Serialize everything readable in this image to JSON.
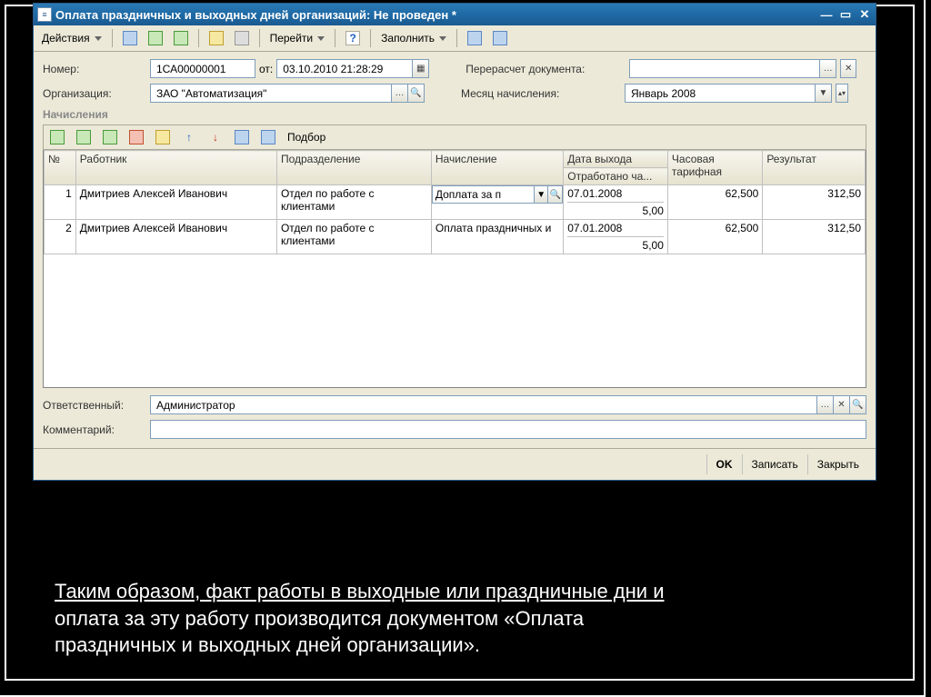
{
  "window": {
    "title": "Оплата праздничных и выходных дней организаций: Не проведен *"
  },
  "toolbar": {
    "actions": "Действия",
    "goto": "Перейти",
    "fill": "Заполнить"
  },
  "form": {
    "number_label": "Номер:",
    "number": "1СА00000001",
    "from_label": "от:",
    "date": "03.10.2010 21:28:29",
    "recalc_label": "Перерасчет документа:",
    "recalc_value": "",
    "org_label": "Организация:",
    "org": "ЗАО \"Автоматизация\"",
    "month_label": "Месяц начисления:",
    "month": "Январь 2008",
    "section": "Начисления",
    "podbor": "Подбор",
    "cols": {
      "n": "№",
      "worker": "Работник",
      "dept": "Подразделение",
      "accrual": "Начисление",
      "date_out": "Дата выхода",
      "worked": "Отработано ча...",
      "hourly": "Часовая тарифная",
      "result": "Результат"
    },
    "responsible_label": "Ответственный:",
    "responsible": "Администратор",
    "comment_label": "Комментарий:",
    "comment": ""
  },
  "rows": [
    {
      "n": "1",
      "worker": "Дмитриев Алексей Иванович",
      "dept": "Отдел по работе с клиентами",
      "accrual": "Доплата за п",
      "date_out": "07.01.2008",
      "worked": "5,00",
      "hourly": "62,500",
      "result": "312,50"
    },
    {
      "n": "2",
      "worker": "Дмитриев Алексей Иванович",
      "dept": "Отдел по работе с клиентами",
      "accrual": "Оплата праздничных и",
      "date_out": "07.01.2008",
      "worked": "5,00",
      "hourly": "62,500",
      "result": "312,50"
    }
  ],
  "buttons": {
    "ok": "OK",
    "save": "Записать",
    "close": "Закрыть"
  },
  "caption": {
    "line1": "Таким образом, факт работы в выходные или праздничные дни и",
    "line2": "оплата за эту работу производится документом «Оплата",
    "line3": "праздничных и выходных дней организации»."
  }
}
